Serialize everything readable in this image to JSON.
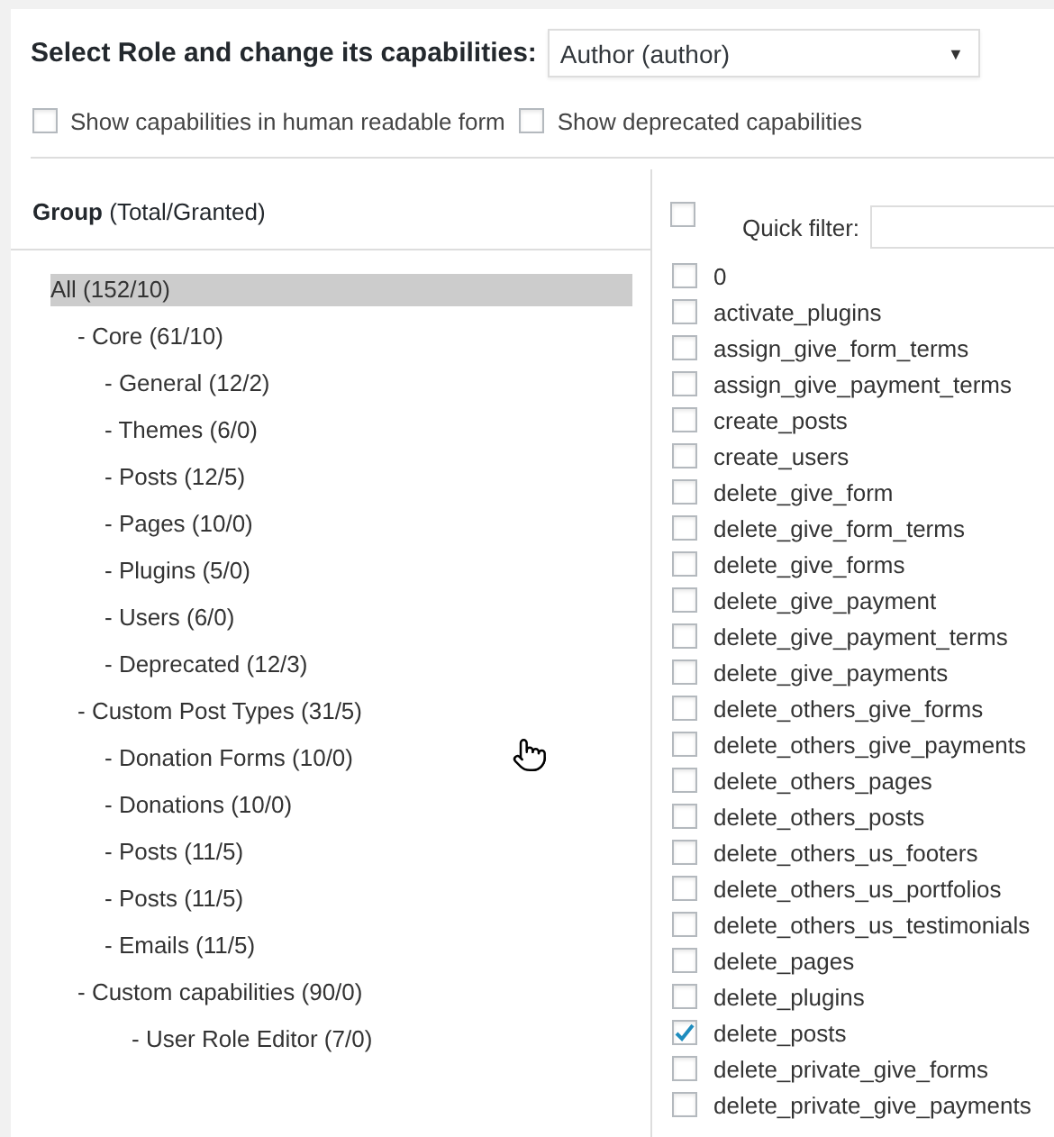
{
  "heading": "Select Role and change its capabilities:",
  "role_select": {
    "value": "Author (author)",
    "arrow": "▼"
  },
  "options": [
    {
      "label": "Show capabilities in human readable form",
      "checked": false
    },
    {
      "label": "Show deprecated capabilities",
      "checked": false
    }
  ],
  "group_header": {
    "title": "Group",
    "note": "(Total/Granted)"
  },
  "capabilities_header": {
    "select_all_checked": false,
    "filter_label": "Quick filter:"
  },
  "groups": [
    {
      "label": "All (152/10)",
      "selected": true,
      "children": [
        {
          "label": "- Core (61/10)",
          "selected": false,
          "children": [
            {
              "label": "- General (12/2)",
              "selected": false
            },
            {
              "label": "- Themes (6/0)",
              "selected": false
            },
            {
              "label": "- Posts (12/5)",
              "selected": false
            },
            {
              "label": "- Pages (10/0)",
              "selected": false
            },
            {
              "label": "- Plugins (5/0)",
              "selected": false
            },
            {
              "label": "- Users (6/0)",
              "selected": false
            },
            {
              "label": "- Deprecated (12/3)",
              "selected": false
            }
          ]
        },
        {
          "label": "- Custom Post Types (31/5)",
          "selected": false,
          "children": [
            {
              "label": "- Donation Forms (10/0)",
              "selected": false
            },
            {
              "label": "- Donations (10/0)",
              "selected": false
            },
            {
              "label": "- Posts (11/5)",
              "selected": false
            },
            {
              "label": "- Posts (11/5)",
              "selected": false
            },
            {
              "label": "- Emails (11/5)",
              "selected": false
            }
          ]
        },
        {
          "label": "- Custom capabilities (90/0)",
          "selected": false,
          "children": [
            {
              "label": "- User Role Editor (7/0)",
              "selected": false,
              "nested": true
            }
          ]
        }
      ]
    }
  ],
  "capabilities": [
    {
      "name": "0",
      "checked": false
    },
    {
      "name": "activate_plugins",
      "checked": false
    },
    {
      "name": "assign_give_form_terms",
      "checked": false
    },
    {
      "name": "assign_give_payment_terms",
      "checked": false
    },
    {
      "name": "create_posts",
      "checked": false
    },
    {
      "name": "create_users",
      "checked": false
    },
    {
      "name": "delete_give_form",
      "checked": false
    },
    {
      "name": "delete_give_form_terms",
      "checked": false
    },
    {
      "name": "delete_give_forms",
      "checked": false
    },
    {
      "name": "delete_give_payment",
      "checked": false
    },
    {
      "name": "delete_give_payment_terms",
      "checked": false
    },
    {
      "name": "delete_give_payments",
      "checked": false
    },
    {
      "name": "delete_others_give_forms",
      "checked": false
    },
    {
      "name": "delete_others_give_payments",
      "checked": false
    },
    {
      "name": "delete_others_pages",
      "checked": false
    },
    {
      "name": "delete_others_posts",
      "checked": false
    },
    {
      "name": "delete_others_us_footers",
      "checked": false
    },
    {
      "name": "delete_others_us_portfolios",
      "checked": false
    },
    {
      "name": "delete_others_us_testimonials",
      "checked": false
    },
    {
      "name": "delete_pages",
      "checked": false
    },
    {
      "name": "delete_plugins",
      "checked": false
    },
    {
      "name": "delete_posts",
      "checked": true
    },
    {
      "name": "delete_private_give_forms",
      "checked": false
    },
    {
      "name": "delete_private_give_payments",
      "checked": false
    }
  ]
}
